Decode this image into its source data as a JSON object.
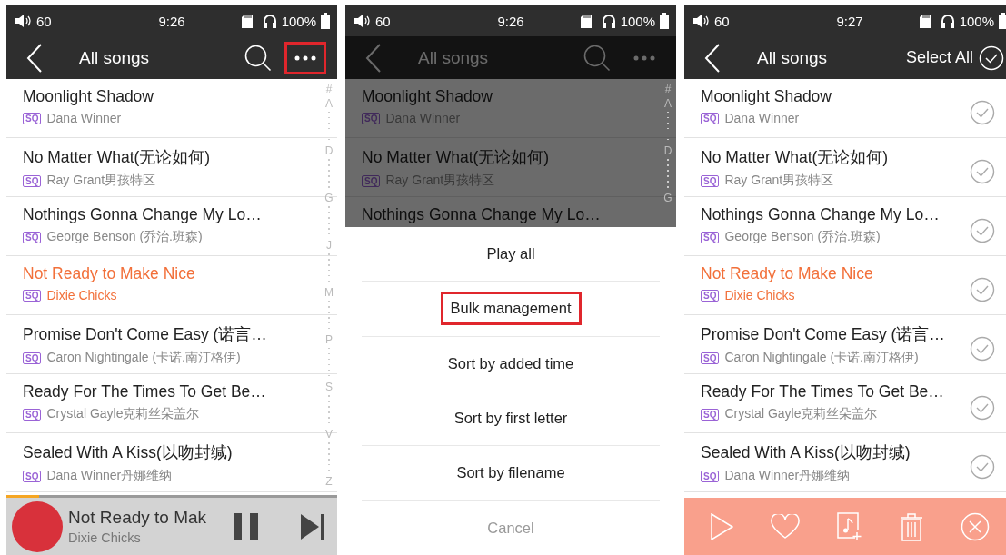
{
  "screens": [
    {
      "kind": "list",
      "status": {
        "volume": "60",
        "time": "9:26",
        "battery": "100%"
      },
      "header": {
        "title": "All songs",
        "more_highlighted": true
      },
      "songs": [
        {
          "title": "Moonlight Shadow",
          "badge": "SQ",
          "artist": "Dana Winner",
          "playing": false
        },
        {
          "title": "No Matter What(无论如何)",
          "badge": "SQ",
          "artist": "Ray Grant男孩特区",
          "playing": false
        },
        {
          "title": "Nothings Gonna Change My Lo…",
          "badge": "SQ",
          "artist": "George Benson (乔治.班森)",
          "playing": false
        },
        {
          "title": "Not Ready to Make Nice",
          "badge": "SQ",
          "artist": "Dixie Chicks",
          "playing": true
        },
        {
          "title": "Promise Don't Come Easy (诺言…",
          "badge": "SQ",
          "artist": "Caron Nightingale (卡诺.南汀格伊)",
          "playing": false
        },
        {
          "title": "Ready For The Times To Get Be…",
          "badge": "SQ",
          "artist": "Crystal Gayle克莉丝朵盖尔",
          "playing": false
        },
        {
          "title": "Sealed With A Kiss(以吻封缄)",
          "badge": "SQ",
          "artist": "Dana Winner丹娜维纳",
          "playing": false
        }
      ],
      "index_letters": [
        "#",
        "A",
        "D",
        "G",
        "J",
        "M",
        "P",
        "S",
        "V",
        "Z"
      ],
      "now_playing": {
        "title": "Not Ready to Mak",
        "artist": "Dixie Chicks",
        "level": 0.1
      }
    },
    {
      "kind": "menu",
      "status": {
        "volume": "60",
        "time": "9:26",
        "battery": "100%"
      },
      "header": {
        "title": "All songs",
        "more_highlighted": false
      },
      "songs": [
        {
          "title": "Moonlight Shadow",
          "badge": "SQ",
          "artist": "Dana Winner",
          "playing": false
        },
        {
          "title": "No Matter What(无论如何)",
          "badge": "SQ",
          "artist": "Ray Grant男孩特区",
          "playing": false
        },
        {
          "title": "Nothings Gonna Change My Lo…",
          "playing": false
        }
      ],
      "index_letters": [
        "#",
        "A",
        "D",
        "G"
      ],
      "menu": [
        {
          "label": "Play all",
          "highlighted": false
        },
        {
          "label": "Bulk management",
          "highlighted": true
        },
        {
          "label": "Sort by added time",
          "highlighted": false
        },
        {
          "label": "Sort by first letter",
          "highlighted": false
        },
        {
          "label": "Sort by filename",
          "highlighted": false
        }
      ],
      "cancel": "Cancel"
    },
    {
      "kind": "select",
      "status": {
        "volume": "60",
        "time": "9:27",
        "battery": "100%"
      },
      "header": {
        "title": "All songs",
        "select_all": "Select All"
      },
      "songs": [
        {
          "title": "Moonlight Shadow",
          "badge": "SQ",
          "artist": "Dana Winner",
          "playing": false,
          "checked": false
        },
        {
          "title": "No Matter What(无论如何)",
          "badge": "SQ",
          "artist": "Ray Grant男孩特区",
          "playing": false,
          "checked": false
        },
        {
          "title": "Nothings Gonna Change My Lo…",
          "badge": "SQ",
          "artist": "George Benson (乔治.班森)",
          "playing": false,
          "checked": false
        },
        {
          "title": "Not Ready to Make Nice",
          "badge": "SQ",
          "artist": "Dixie Chicks",
          "playing": true,
          "checked": false
        },
        {
          "title": "Promise Don't Come Easy (诺言…",
          "badge": "SQ",
          "artist": "Caron Nightingale (卡诺.南汀格伊)",
          "playing": false,
          "checked": false
        },
        {
          "title": "Ready For The Times To Get Be…",
          "badge": "SQ",
          "artist": "Crystal Gayle克莉丝朵盖尔",
          "playing": false,
          "checked": false
        },
        {
          "title": "Sealed With A Kiss(以吻封缄)",
          "badge": "SQ",
          "artist": "Dana Winner丹娜维纳",
          "playing": false,
          "checked": false
        }
      ]
    }
  ]
}
